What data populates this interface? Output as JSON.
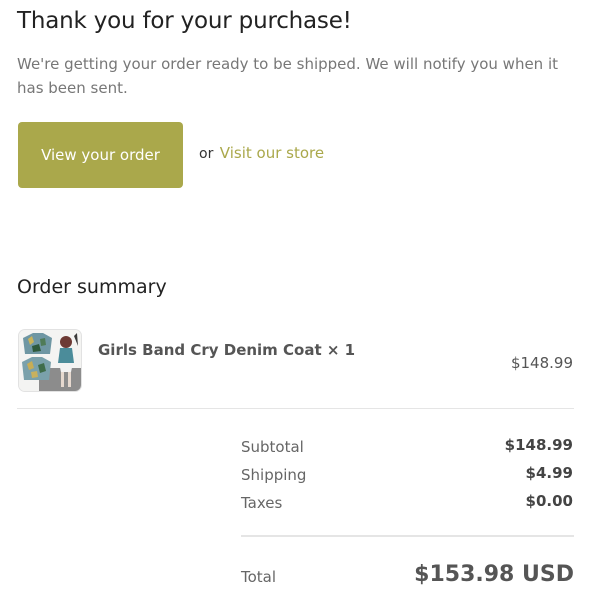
{
  "confirmation": {
    "title": "Thank you for your purchase!",
    "message": "We're getting your order ready to be shipped. We will notify you when it has been sent.",
    "view_order_label": "View your order",
    "or_text": "or",
    "visit_store_label": "Visit our store"
  },
  "summary": {
    "title": "Order summary",
    "item": {
      "name": "Girls Band Cry Denim Coat × 1",
      "price": "$148.99"
    },
    "subtotal_label": "Subtotal",
    "subtotal_value": "$148.99",
    "shipping_label": "Shipping",
    "shipping_value": "$4.99",
    "taxes_label": "Taxes",
    "taxes_value": "$0.00",
    "total_label": "Total",
    "total_value": "$153.98 USD"
  },
  "colors": {
    "accent": "#aaa84b",
    "text_muted": "#777777",
    "divider": "#e5e5e5"
  }
}
